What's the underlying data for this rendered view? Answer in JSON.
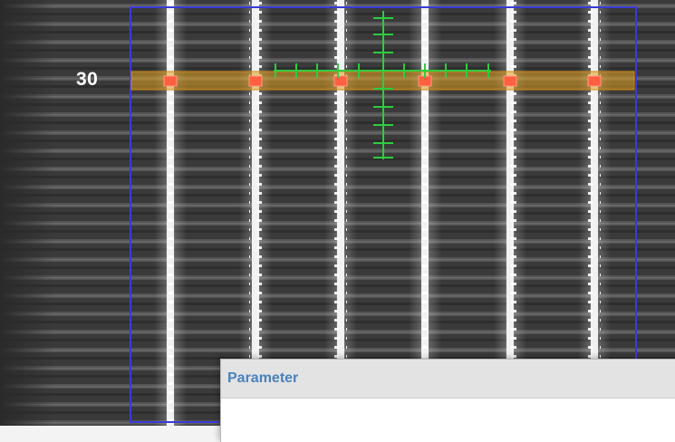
{
  "viewer": {
    "row_label": "30",
    "line_count": 6,
    "colors": {
      "background": "#3a3a3a",
      "line_glow": "#ffffff",
      "roi_border": "#3a3ad8",
      "selection_band": "#e0a020",
      "marker": "#ff6040",
      "crosshair": "#2ecc40"
    }
  },
  "dialog": {
    "title": "Parameter"
  }
}
